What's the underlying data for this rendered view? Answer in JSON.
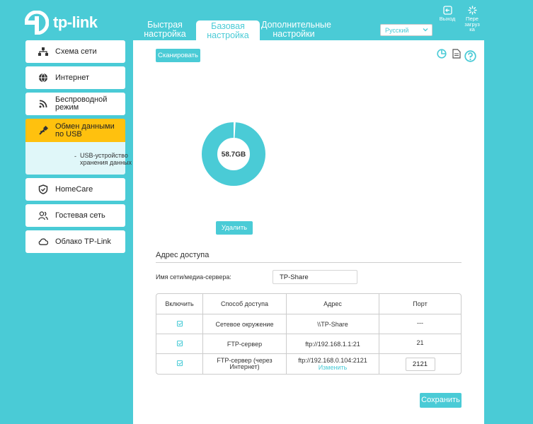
{
  "header": {
    "logo_text": "tp-link",
    "tabs": [
      {
        "line1": "Быстрая",
        "line2": "настройка",
        "active": false
      },
      {
        "line1": "Базовая",
        "line2": "настройка",
        "active": true
      },
      {
        "line1": "Дополнительные",
        "line2": "настройки",
        "active": false
      }
    ],
    "language": "Русский",
    "logout_label": "Выход",
    "reboot_label": [
      "Пере",
      "загруз",
      "ка"
    ]
  },
  "sidebar": {
    "items": [
      {
        "label": "Схема сети",
        "icon": "network-map-icon"
      },
      {
        "label": "Интернет",
        "icon": "globe-icon"
      },
      {
        "label": "Беспроводной режим",
        "icon": "wifi-icon"
      },
      {
        "label": "Обмен данными по USB",
        "icon": "usb-icon",
        "active": true
      },
      {
        "label": "HomeCare",
        "icon": "shield-icon"
      },
      {
        "label": "Гостевая сеть",
        "icon": "guests-icon"
      },
      {
        "label": "Облако TP-Link",
        "icon": "cloud-icon"
      }
    ],
    "sub_item": "USB-устройство хранения данных"
  },
  "main": {
    "scan_label": "Сканировать",
    "storage_total": "58.7GB",
    "storage_used_fraction": 0.01,
    "delete_label": "Удалить",
    "section_title": "Адрес доступа",
    "server_name_label": "Имя сети/медиа-сервера:",
    "server_name_value": "TP-Share",
    "table": {
      "headers": [
        "Включить",
        "Способ доступа",
        "Адрес",
        "Порт"
      ],
      "rows": [
        {
          "enabled": true,
          "method": "Сетевое окружение",
          "address": "\\\\TP-Share",
          "port": "---"
        },
        {
          "enabled": true,
          "method": "FTP-сервер",
          "address": "ftp://192.168.1.1:21",
          "port": "21"
        },
        {
          "enabled": true,
          "method": "FTP-сервер (через Интернет)",
          "address": "ftp://192.168.0.104:2121",
          "address_link": "Изменить",
          "port": "2121"
        }
      ]
    },
    "save_label": "Сохранить"
  },
  "colors": {
    "accent": "#4acbd6",
    "active_nav": "#ffc10e"
  }
}
